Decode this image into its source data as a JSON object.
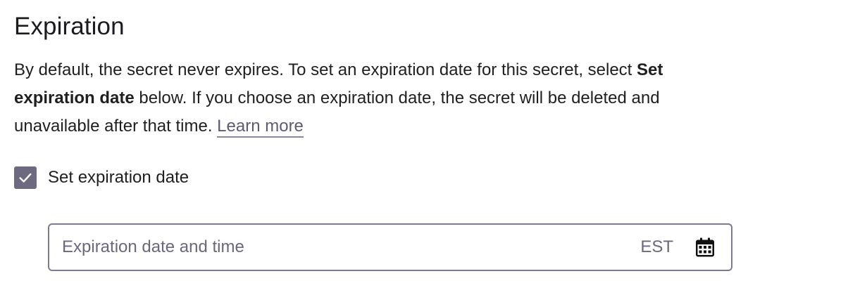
{
  "section": {
    "title": "Expiration",
    "description": {
      "part1": "By default, the secret never expires. To set an expiration date for this secret, select ",
      "bold": "Set expiration date",
      "part2": " below. If you choose an expiration date, the secret will be deleted and unavailable after that time. ",
      "link": "Learn more"
    }
  },
  "checkbox": {
    "label": "Set expiration date",
    "checked": true,
    "color": "#6d6a80"
  },
  "date_field": {
    "placeholder": "Expiration date and time",
    "value": "",
    "timezone": "EST",
    "icon": "calendar-icon"
  }
}
